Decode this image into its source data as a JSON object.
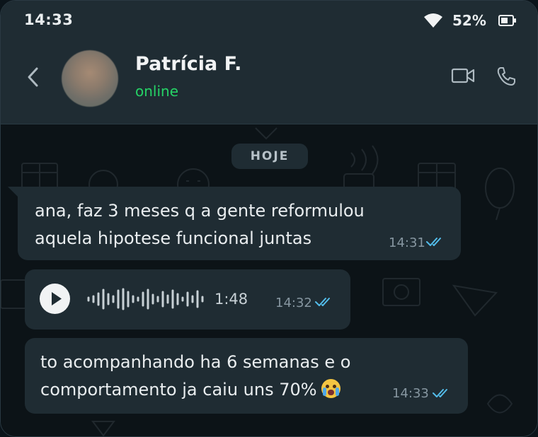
{
  "status_bar": {
    "time": "14:33",
    "battery_percent": "52%",
    "wifi_icon": "wifi-icon",
    "battery_icon": "battery-icon"
  },
  "header": {
    "back_icon": "chevron-left-icon",
    "contact_name": "Patrícia F.",
    "presence": "online",
    "video_icon": "video-call-icon",
    "phone_icon": "phone-icon"
  },
  "chat": {
    "day_label": "HOJE",
    "messages": [
      {
        "type": "text",
        "lines": [
          "ana, faz 3 meses q a gente reformulou",
          "aquela hipotese funcional juntas"
        ],
        "time": "14:31",
        "status": "read"
      },
      {
        "type": "voice",
        "duration": "1:48",
        "time": "14:32",
        "status": "read"
      },
      {
        "type": "text",
        "lines": [
          "to acompanhando ha 6 semanas e o",
          "comportamento ja caiu uns 70%"
        ],
        "emoji": "crying-face-emoji",
        "time": "14:33",
        "status": "read"
      }
    ]
  },
  "colors": {
    "accent_online": "#25d366",
    "read_ticks": "#53bdeb",
    "bubble": "#1f2c33",
    "header": "#1f2c33",
    "background": "#0b141a"
  }
}
